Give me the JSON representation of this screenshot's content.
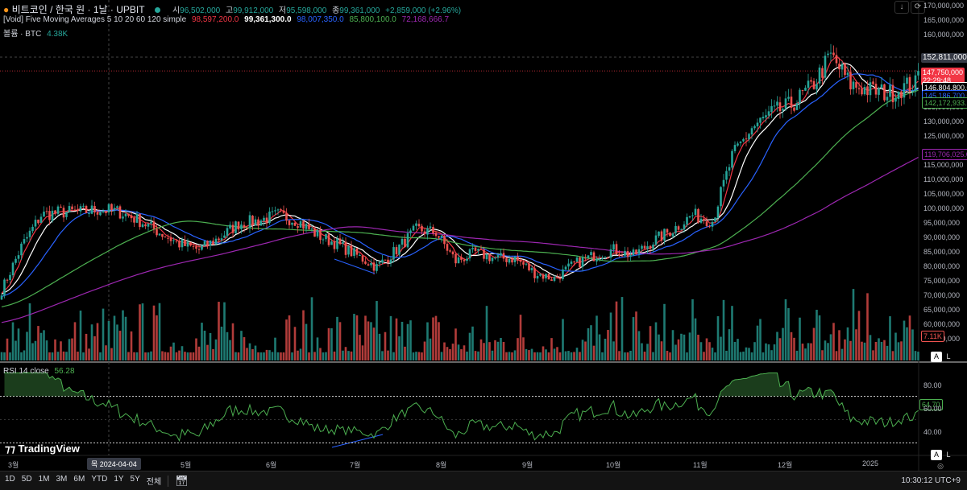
{
  "header": {
    "symbol": "비트코인 / 한국 원 · 1날 · UPBIT",
    "open_label": "시",
    "open": "96,502,000",
    "high_label": "고",
    "high": "99,912,000",
    "low_label": "저",
    "low": "95,598,000",
    "close_label": "종",
    "close": "99,361,000",
    "change": "+2,859,000 (+2.96%)"
  },
  "indicator": {
    "name": "[Void] Five Moving Averages 5 10 20 60 120 simple",
    "values": [
      "98,597,200.0",
      "99,361,300.0",
      "98,007,350.0",
      "85,800,100.0",
      "72,168,666.7"
    ],
    "colors": [
      "#f23645",
      "#ffffff",
      "#2962ff",
      "#4caf50",
      "#9c27b0"
    ]
  },
  "volume": {
    "label": "볼륨 · BTC",
    "value": "4.38K",
    "last_label": "7.11K"
  },
  "rsi": {
    "label": "RSI 14 close",
    "value": "56.28",
    "last_label": "64.70",
    "axis": [
      "80.00",
      "60.00",
      "40.00"
    ],
    "upper_band": 70,
    "lower_band": 30
  },
  "top_tools": {
    "download_icon": "↓",
    "reset_icon": "⟳"
  },
  "price_axis": {
    "labels": [
      "170,000,000",
      "165,000,000",
      "160,000,000",
      "135,000,000",
      "130,000,000",
      "125,000,000",
      "115,000,000",
      "110,000,000",
      "105,000,000",
      "100,000,000",
      "95,000,000",
      "90,000,000",
      "85,000,000",
      "80,000,000",
      "75,000,000",
      "70,000,000",
      "65,000,000",
      "60,000,000",
      "55,000,000"
    ],
    "crosshair": "152,811,000",
    "last_price": "147,750,000",
    "countdown": "22:29:48",
    "ma10": "146,804,800.0",
    "ma20": "145,186,700.0",
    "ma60": "142,172,933.3",
    "ma120": "119,706,025.0"
  },
  "time_axis": {
    "labels": [
      "3월",
      "5월",
      "6월",
      "7월",
      "8월",
      "9월",
      "10월",
      "11월",
      "12월",
      "2025"
    ],
    "crosshair": "목 2024-04-04"
  },
  "scale_buttons": {
    "auto": "A",
    "log": "L"
  },
  "brand": "TradingView",
  "toolbar": {
    "ranges": [
      "1D",
      "5D",
      "1M",
      "3M",
      "6M",
      "YTD",
      "1Y",
      "5Y",
      "전체"
    ],
    "clock": "10:30:12 UTC+9"
  },
  "colors": {
    "up": "#26a69a",
    "down": "#ef5350",
    "background": "#000000"
  },
  "chart_data": {
    "type": "candlestick",
    "interval": "1D",
    "ylim": [
      55000000,
      170000000
    ],
    "weekly_closes_dates_start": "2024-02-26",
    "weekly_closes_millions": [
      72,
      87,
      98,
      99,
      99,
      100,
      99,
      96,
      92,
      88,
      86,
      90,
      95,
      96,
      98,
      96,
      91,
      88,
      84,
      80,
      86,
      93,
      92,
      82,
      85,
      83,
      83,
      78,
      76,
      81,
      84,
      86,
      84,
      89,
      93,
      98,
      96,
      118,
      128,
      133,
      136,
      142,
      153,
      143,
      141,
      140,
      143
    ],
    "last_close": 147750000,
    "moving_averages": [
      5,
      10,
      20,
      60,
      120
    ]
  }
}
